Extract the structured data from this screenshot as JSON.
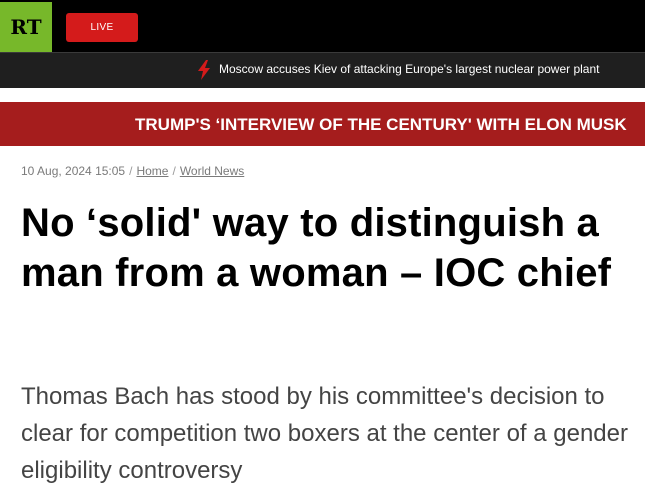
{
  "header": {
    "logo_text": "RT",
    "live_label": "LIVE"
  },
  "ticker": {
    "icon": "lightning-icon",
    "text": "Moscow accuses Kiev of attacking Europe's largest nuclear power plant"
  },
  "banner": {
    "text": "TRUMP'S ‘INTERVIEW OF THE CENTURY' WITH ELON MUSK"
  },
  "article": {
    "date": "10 Aug, 2024 15:05",
    "separator": "/",
    "breadcrumb": [
      "Home",
      "World News"
    ],
    "title": "No ‘solid' way to distinguish a man from a woman – IOC chief",
    "summary": "Thomas Bach has stood by his committee's decision to clear for competition two boxers at the center of a gender eligibility controversy"
  },
  "colors": {
    "logo_green": "#77b82a",
    "live_red": "#d41b1b",
    "banner_red": "#a51d1d",
    "topbar_black": "#000000",
    "ticker_bg": "#1f1f1f"
  }
}
